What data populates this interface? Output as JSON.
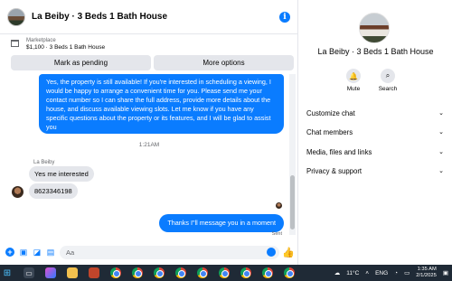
{
  "chat": {
    "title": "La Beiby · 3 Beds 1 Bath House",
    "marketplace_label": "Marketplace",
    "listing": "$1,100 · 3 Beds 1 Bath House",
    "buttons": {
      "mark_pending": "Mark as pending",
      "more_options": "More options"
    },
    "messages": {
      "outgoing_1": "Yes, the property is still available! If you're interested in scheduling a viewing, I would be happy to arrange a convenient time for you. Please send me your contact number so I can share the full address, provide more details about the house, and discuss available viewing slots. Let me know if you have any specific questions about the property or its features, and I will be glad to assist you",
      "timestamp": "1:21AM",
      "sender": "La Beiby",
      "incoming_1": "Yes me interested",
      "incoming_2": "8623346198",
      "outgoing_2": "Thanks I\"ll message you in a moment",
      "status": "Sent"
    },
    "composer_placeholder": "Aa"
  },
  "panel": {
    "name": "La Beiby · 3 Beds 1 Bath House",
    "actions": {
      "mute": "Mute",
      "search": "Search"
    },
    "rows": [
      "Customize chat",
      "Chat members",
      "Media, files and links",
      "Privacy & support"
    ]
  },
  "taskbar": {
    "temperature": "11°C",
    "language": "ENG",
    "time": "1:35 AM",
    "date": "2/1/2025"
  },
  "colors": {
    "accent": "#0a7cff",
    "taskbar": "#1f2a36"
  }
}
